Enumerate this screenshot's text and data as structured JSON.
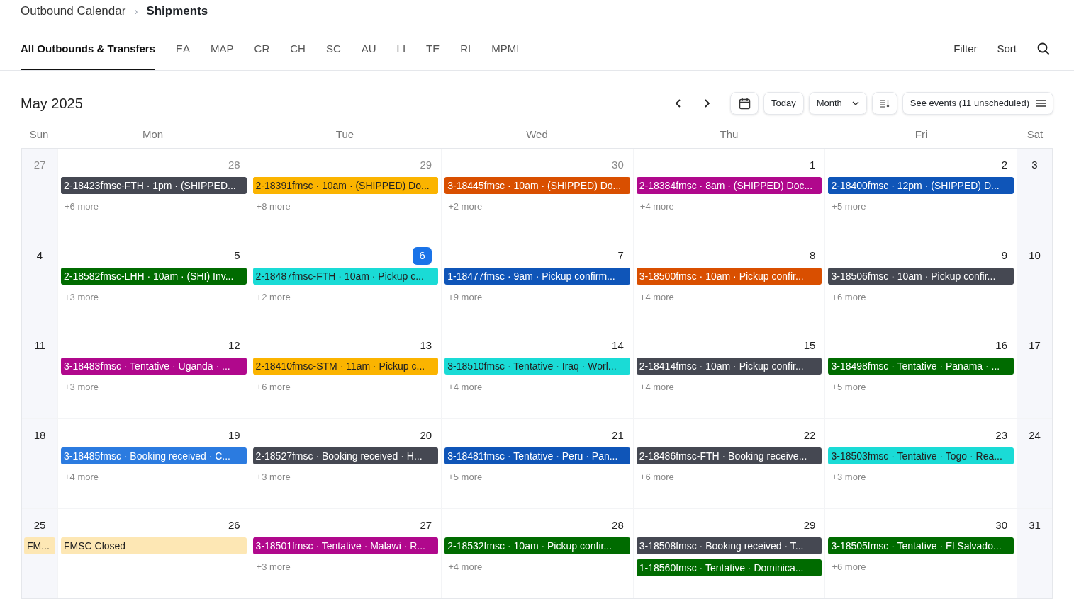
{
  "breadcrumb": {
    "parent": "Outbound Calendar",
    "separator": "›",
    "current": "Shipments"
  },
  "tabs": [
    {
      "label": "All Outbounds & Transfers",
      "selected": true
    },
    {
      "label": "EA",
      "selected": false
    },
    {
      "label": "MAP",
      "selected": false
    },
    {
      "label": "CR",
      "selected": false
    },
    {
      "label": "CH",
      "selected": false
    },
    {
      "label": "SC",
      "selected": false
    },
    {
      "label": "AU",
      "selected": false
    },
    {
      "label": "LI",
      "selected": false
    },
    {
      "label": "TE",
      "selected": false
    },
    {
      "label": "RI",
      "selected": false
    },
    {
      "label": "MPMI",
      "selected": false
    }
  ],
  "actions": [
    "Filter",
    "Sort"
  ],
  "calendar": {
    "title": "May 2025",
    "today_button": "Today",
    "view": "Month",
    "see_events": "See events (11 unscheduled)",
    "weekdays": [
      "Sun",
      "Mon",
      "Tue",
      "Wed",
      "Thu",
      "Fri",
      "Sat"
    ],
    "weeks": [
      {
        "days": [
          {
            "date": "27",
            "muted": true,
            "today": false
          },
          {
            "date": "28",
            "muted": true,
            "today": false,
            "events": [
              {
                "text": "2-18423fmsc-FTH · 1pm · (SHIPPED...",
                "color": "#454852"
              }
            ],
            "more": "+6 more"
          },
          {
            "date": "29",
            "muted": true,
            "today": false,
            "events": [
              {
                "text": "2-18391fmsc · 10am · (SHIPPED) Do...",
                "color": "#fbb400"
              }
            ],
            "more": "+8 more"
          },
          {
            "date": "30",
            "muted": true,
            "today": false,
            "events": [
              {
                "text": "3-18445fmsc · 10am · (SHIPPED) Do...",
                "color": "#d94f00"
              }
            ],
            "more": "+2 more"
          },
          {
            "date": "1",
            "muted": false,
            "today": false,
            "events": [
              {
                "text": "2-18384fmsc · 8am · (SHIPPED) Doc...",
                "color": "#b0088c"
              }
            ],
            "more": "+4 more"
          },
          {
            "date": "2",
            "muted": false,
            "today": false,
            "events": [
              {
                "text": "2-18400fmsc · 12pm · (SHIPPED) D...",
                "color": "#0f55b8"
              }
            ],
            "more": "+5 more"
          },
          {
            "date": "3",
            "muted": false,
            "today": false
          }
        ]
      },
      {
        "days": [
          {
            "date": "4",
            "muted": false,
            "today": false
          },
          {
            "date": "5",
            "muted": false,
            "today": false,
            "events": [
              {
                "text": "2-18582fmsc-LHH · 10am · (SHI) Inv...",
                "color": "#006b00"
              }
            ],
            "more": "+3 more"
          },
          {
            "date": "6",
            "muted": false,
            "today": true,
            "events": [
              {
                "text": "2-18487fmsc-FTH · 10am · Pickup c...",
                "color": "#1adbd6"
              }
            ],
            "more": "+2 more"
          },
          {
            "date": "7",
            "muted": false,
            "today": false,
            "events": [
              {
                "text": "1-18477fmsc · 9am · Pickup confirm...",
                "color": "#0f55b8"
              }
            ],
            "more": "+9 more"
          },
          {
            "date": "8",
            "muted": false,
            "today": false,
            "events": [
              {
                "text": "3-18500fmsc · 10am · Pickup confir...",
                "color": "#d94f00"
              }
            ],
            "more": "+4 more"
          },
          {
            "date": "9",
            "muted": false,
            "today": false,
            "events": [
              {
                "text": "3-18506fmsc · 10am · Pickup confir...",
                "color": "#454852"
              }
            ],
            "more": "+6 more"
          },
          {
            "date": "10",
            "muted": false,
            "today": false
          }
        ]
      },
      {
        "days": [
          {
            "date": "11",
            "muted": false,
            "today": false
          },
          {
            "date": "12",
            "muted": false,
            "today": false,
            "events": [
              {
                "text": "3-18483fmsc · Tentative · Uganda · ...",
                "color": "#b0088c"
              }
            ],
            "more": "+3 more"
          },
          {
            "date": "13",
            "muted": false,
            "today": false,
            "events": [
              {
                "text": "2-18410fmsc-STM · 11am · Pickup c...",
                "color": "#fbb400"
              }
            ],
            "more": "+6 more"
          },
          {
            "date": "14",
            "muted": false,
            "today": false,
            "events": [
              {
                "text": "3-18510fmsc · Tentative · Iraq · Worl...",
                "color": "#1adbd6"
              }
            ],
            "more": "+4 more"
          },
          {
            "date": "15",
            "muted": false,
            "today": false,
            "events": [
              {
                "text": "2-18414fmsc · 10am · Pickup confir...",
                "color": "#454852"
              }
            ],
            "more": "+4 more"
          },
          {
            "date": "16",
            "muted": false,
            "today": false,
            "events": [
              {
                "text": "3-18498fmsc · Tentative · Panama · ...",
                "color": "#006b00"
              }
            ],
            "more": "+5 more"
          },
          {
            "date": "17",
            "muted": false,
            "today": false
          }
        ]
      },
      {
        "days": [
          {
            "date": "18",
            "muted": false,
            "today": false
          },
          {
            "date": "19",
            "muted": false,
            "today": false,
            "events": [
              {
                "text": "3-18485fmsc · Booking received · C...",
                "color": "#2b7be0"
              }
            ],
            "more": "+4 more"
          },
          {
            "date": "20",
            "muted": false,
            "today": false,
            "events": [
              {
                "text": "2-18527fmsc · Booking received · H...",
                "color": "#454852"
              }
            ],
            "more": "+3 more"
          },
          {
            "date": "21",
            "muted": false,
            "today": false,
            "events": [
              {
                "text": "3-18481fmsc · Tentative · Peru · Pan...",
                "color": "#0f55b8"
              }
            ],
            "more": "+5 more"
          },
          {
            "date": "22",
            "muted": false,
            "today": false,
            "events": [
              {
                "text": "2-18486fmsc-FTH · Booking receive...",
                "color": "#454852"
              }
            ],
            "more": "+6 more"
          },
          {
            "date": "23",
            "muted": false,
            "today": false,
            "events": [
              {
                "text": "3-18503fmsc · Tentative · Togo · Rea...",
                "color": "#1adbd6"
              }
            ],
            "more": "+3 more"
          },
          {
            "date": "24",
            "muted": false,
            "today": false
          }
        ]
      },
      {
        "days": [
          {
            "date": "25",
            "muted": false,
            "today": false,
            "events": [
              {
                "text": "FM...",
                "color": "#fde7b4"
              }
            ]
          },
          {
            "date": "26",
            "muted": false,
            "today": false,
            "events": [
              {
                "text": "FMSC Closed",
                "color": "#fde7b4"
              }
            ]
          },
          {
            "date": "27",
            "muted": false,
            "today": false,
            "events": [
              {
                "text": "3-18501fmsc · Tentative · Malawi · R...",
                "color": "#b0088c"
              }
            ],
            "more": "+3 more"
          },
          {
            "date": "28",
            "muted": false,
            "today": false,
            "events": [
              {
                "text": "2-18532fmsc · 10am · Pickup confir...",
                "color": "#006b00"
              }
            ],
            "more": "+4 more"
          },
          {
            "date": "29",
            "muted": false,
            "today": false,
            "events": [
              {
                "text": "3-18508fmsc · Booking received · T...",
                "color": "#454852"
              },
              {
                "text": "1-18560fmsc · Tentative · Dominica...",
                "color": "#006b00"
              }
            ]
          },
          {
            "date": "30",
            "muted": false,
            "today": false,
            "events": [
              {
                "text": "3-18505fmsc · Tentative · El Salvado...",
                "color": "#006b00"
              }
            ],
            "more": "+6 more"
          },
          {
            "date": "31",
            "muted": false,
            "today": false
          }
        ]
      }
    ]
  }
}
